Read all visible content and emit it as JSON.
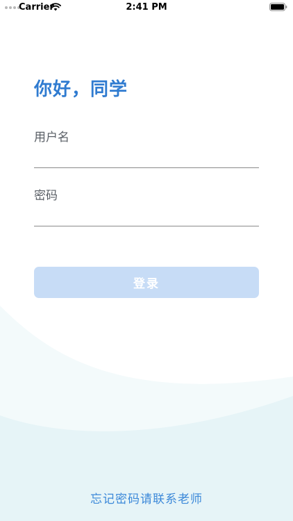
{
  "status_bar": {
    "carrier": "Carrier",
    "time": "2:41 PM"
  },
  "login": {
    "greeting": "你好，同学",
    "username_label": "用户名",
    "username_value": "",
    "password_label": "密码",
    "password_value": "",
    "submit_label": "登录",
    "forgot_text": "忘记密码请联系老师"
  },
  "colors": {
    "accent": "#2f7bd0",
    "button_disabled": "#c7dcf6",
    "link": "#3b88d9",
    "wave_light": "#f3fafb",
    "wave_dark": "#e6f4f7"
  }
}
